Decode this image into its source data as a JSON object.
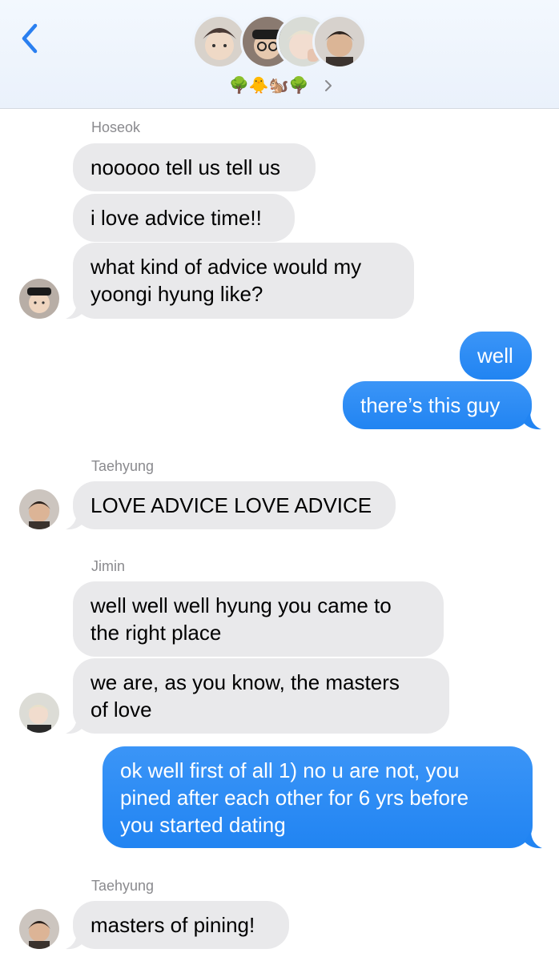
{
  "header": {
    "participant_emojis": "🌳🐥🐿️🌳",
    "avatars": [
      "hoseok-avatar",
      "namjoon-avatar",
      "jimin-avatar",
      "taehyung-avatar"
    ]
  },
  "colors": {
    "incoming_bubble": "#e9e9eb",
    "outgoing_bubble": "#2184f2",
    "accent_blue": "#2a7ff0",
    "sender_name": "#8a8a8e"
  },
  "messages": [
    {
      "sender": "Hoseok"
    },
    {
      "text": "nooooo tell us tell us"
    },
    {
      "text": "i love advice time!!"
    },
    {
      "text_lines": [
        "what kind of advice would my",
        "yoongi hyung like?"
      ]
    },
    {
      "text": "well",
      "outgoing": true
    },
    {
      "text": "there’s this guy",
      "outgoing": true
    },
    {
      "sender": "Taehyung"
    },
    {
      "text": "LOVE ADVICE LOVE ADVICE"
    },
    {
      "sender": "Jimin"
    },
    {
      "text_lines": [
        "well well well hyung you came to",
        "the right place"
      ]
    },
    {
      "text_lines": [
        "we are, as you know, the masters",
        "of love"
      ]
    },
    {
      "text_lines": [
        "ok well first of all 1) no u are not, you",
        "pined after each other for 6 yrs before",
        "you started dating"
      ],
      "outgoing": true
    },
    {
      "sender": "Taehyung"
    },
    {
      "text": "masters of pining!"
    }
  ]
}
